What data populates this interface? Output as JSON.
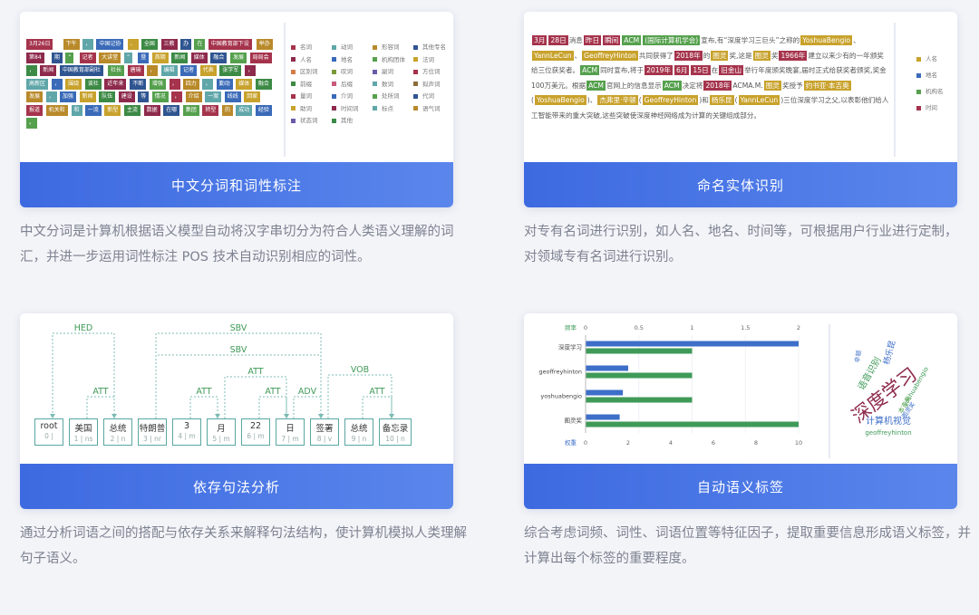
{
  "cards": [
    {
      "title": "中文分词和词性标注",
      "desc": "中文分词是计算机根据语义模型自动将汉字串切分为符合人类语义理解的词汇，并进一步运用词性标注 POS 技术自动识别相应的词性。",
      "chips": [
        "3月26日",
        "下午",
        "，",
        "中国记协",
        "、",
        "全国",
        "三教",
        "办",
        "在",
        "中国教育部下设",
        "举办",
        "第84",
        "期",
        "“",
        "记者",
        "大讲堂",
        "”",
        "暨",
        "首期",
        "新闻",
        "媒体",
        "融合",
        "发展",
        "局局会",
        "，",
        "新闻",
        "中国教育部副社",
        "社长",
        "唐瑜",
        "，",
        "编辑",
        "记者",
        "代表",
        "张学军",
        "，",
        "高新区",
        "，",
        "围绕",
        "谈社",
        "近年来",
        "不断",
        "增强",
        "，",
        "四力",
        "，",
        "勤动",
        "媒体",
        "融合",
        "发展",
        "，",
        "加强",
        "新闻",
        "队伍",
        "建设",
        "等",
        "情况",
        "，",
        "介绍",
        "一案",
        "线线",
        "回家",
        "报道",
        "机关和",
        "和",
        "一流",
        "新型",
        "主流",
        "数据",
        "在哪",
        "集团",
        "转型",
        "的",
        "成功",
        "经验",
        "。"
      ],
      "legend": [
        "名词",
        "动词",
        "形容词",
        "其他专名",
        "人名",
        "地名",
        "机构团体",
        "法词",
        "区别词",
        "叹词",
        "副词",
        "方位词",
        "前缀",
        "后缀",
        "数词",
        "拟声词",
        "量词",
        "介词",
        "处所词",
        "代词",
        "助词",
        "时间词",
        "标点",
        "语气词",
        "状态词",
        "其他"
      ]
    },
    {
      "title": "命名实体识别",
      "desc": "对专有名词进行识别，如人名、地名、时间等，可根据用户行业进行定制，对领域专有名词进行识别。",
      "legend": [
        "人名",
        "地名",
        "机构名",
        "时间"
      ],
      "segments": [
        {
          "t": "3月",
          "c": "time"
        },
        {
          "t": "28日",
          "c": "time"
        },
        {
          "t": "消息"
        },
        {
          "t": "昨日",
          "c": "time"
        },
        {
          "t": "瞬间",
          "c": "time"
        },
        {
          "t": "ACM",
          "c": "org"
        },
        {
          "t": "(国际计算机学会)",
          "c": "org"
        },
        {
          "t": "宣布,有“深度学习三巨头”之称的"
        },
        {
          "t": "YoshuaBengio",
          "c": "per"
        },
        {
          "t": "、"
        },
        {
          "t": "YannLeCun",
          "c": "per"
        },
        {
          "t": "、"
        },
        {
          "t": "GeoffreyHinton",
          "c": "per"
        },
        {
          "t": "共同获得了"
        },
        {
          "t": "2018年",
          "c": "time"
        },
        {
          "t": "的"
        },
        {
          "t": "图灵",
          "c": "per"
        },
        {
          "t": "奖,这是"
        },
        {
          "t": "图灵",
          "c": "per"
        },
        {
          "t": "奖"
        },
        {
          "t": "1966年",
          "c": "time"
        },
        {
          "t": "建立以来少有的一年颁奖给三位获奖者。"
        },
        {
          "t": "ACM",
          "c": "org"
        },
        {
          "t": "同时宣布,将于"
        },
        {
          "t": "2019年",
          "c": "time"
        },
        {
          "t": "6月",
          "c": "time"
        },
        {
          "t": "15日",
          "c": "time"
        },
        {
          "t": "在"
        },
        {
          "t": "旧金山",
          "c": "loc"
        },
        {
          "t": "举行年度颁奖晚宴,届时正式给获奖者颁奖,奖金100万美元。根据"
        },
        {
          "t": "ACM",
          "c": "org"
        },
        {
          "t": "官网上的信息显示"
        },
        {
          "t": "ACM",
          "c": "org"
        },
        {
          "t": "决定将"
        },
        {
          "t": "2018年",
          "c": "time"
        },
        {
          "t": "ACMA.M."
        },
        {
          "t": "图灵",
          "c": "per"
        },
        {
          "t": "奖授予"
        },
        {
          "t": "约书亚·本吉奥",
          "c": "per"
        },
        {
          "t": "("
        },
        {
          "t": "YoshuaBengio",
          "c": "per"
        },
        {
          "t": ")、"
        },
        {
          "t": "杰弗里·辛顿",
          "c": "per"
        },
        {
          "t": "("
        },
        {
          "t": "GeoffreyHinton",
          "c": "per"
        },
        {
          "t": ")和"
        },
        {
          "t": "杨乐昆",
          "c": "per"
        },
        {
          "t": "("
        },
        {
          "t": "YannLeCun",
          "c": "per"
        },
        {
          "t": ")三位深度学习之父,以表彰他们给人工智能带来的重大突破,这些突破使深度神经网络成为计算的关键组成部分。"
        }
      ]
    },
    {
      "title": "依存句法分析",
      "desc": "通过分析词语之间的搭配与依存关系来解释句法结构，使计算机模拟人类理解句子语义。",
      "tokens": [
        {
          "w": "root",
          "p": "0 |"
        },
        {
          "w": "美国",
          "p": "1 | ns"
        },
        {
          "w": "总统",
          "p": "2 | n"
        },
        {
          "w": "特朗普",
          "p": "3 | nr"
        },
        {
          "w": "3",
          "p": "4 | m"
        },
        {
          "w": "月",
          "p": "5 | m"
        },
        {
          "w": "22",
          "p": "6 | m"
        },
        {
          "w": "日",
          "p": "7 | m"
        },
        {
          "w": "签署",
          "p": "8 | v"
        },
        {
          "w": "总统",
          "p": "9 | n"
        },
        {
          "w": "备忘录",
          "p": "10 | n"
        }
      ],
      "arcs": [
        {
          "from": 2,
          "to": 0,
          "label": "HED",
          "level": 3
        },
        {
          "from": 3,
          "to": 8,
          "label": "SBV",
          "level": 3
        },
        {
          "from": 3,
          "to": 8,
          "label": "SBV",
          "level": 2
        },
        {
          "from": 1,
          "to": 2,
          "label": "ATT",
          "level": 1
        },
        {
          "from": 4,
          "to": 5,
          "label": "ATT",
          "level": 1
        },
        {
          "from": 5,
          "to": 7,
          "label": "ATT",
          "level": 2
        },
        {
          "from": 6,
          "to": 7,
          "label": "ATT",
          "level": 1
        },
        {
          "from": 7,
          "to": 8,
          "label": "ADV",
          "level": 1
        },
        {
          "from": 8,
          "to": 10,
          "label": "VOB",
          "level": 2
        },
        {
          "from": 9,
          "to": 10,
          "label": "ATT",
          "level": 1
        }
      ]
    },
    {
      "title": "自动语义标签",
      "desc": "综合考虑词频、词性、词语位置等特征因子，提取重要信息形成语义标签，并计算出每个标签的重要程度。",
      "chart_data": {
        "type": "bar",
        "categories": [
          "深度学习",
          "geoffreyhinton",
          "yoshuabengio",
          "图灵奖"
        ],
        "series": [
          {
            "name": "频率",
            "values": [
              2.0,
              0.4,
              0.35,
              0.32
            ],
            "color": "#3d6ec8"
          },
          {
            "name": "权重",
            "values": [
              5.0,
              5.0,
              5.0,
              10.0
            ],
            "color": "#3f9a58"
          }
        ],
        "top_axis": {
          "label": "频率",
          "ticks": [
            0,
            0.5,
            1,
            1.5,
            2
          ],
          "max": 2
        },
        "bottom_axis": {
          "label": "权重",
          "ticks": [
            0,
            2,
            4,
            6,
            8,
            10
          ],
          "max": 10
        }
      },
      "wordcloud": [
        "深度学习",
        "语音识别",
        "计算机视觉",
        "geoffreyhinton",
        "杨乐昆",
        "yoshuabengio",
        "图灵奖",
        "辛顿",
        "本吉奥"
      ]
    }
  ],
  "colors": {
    "accent": "#3d6ae0",
    "background": "#f3f4f8"
  }
}
